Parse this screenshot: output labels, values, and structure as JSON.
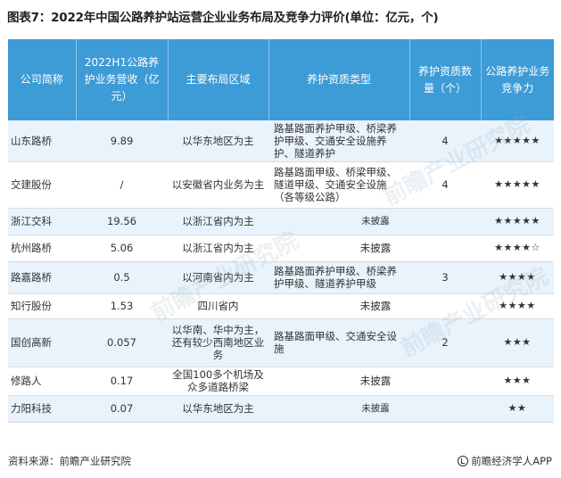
{
  "title": "图表7：2022年中国公路养护站运营企业业务布局及竞争力评价(单位：亿元，个)",
  "headers": [
    "公司简称",
    "2022H1公路养护业务营收（亿元）",
    "主要布局区域",
    "养护资质类型",
    "养护资质数量（个）",
    "公路养护业务竞争力"
  ],
  "rows": [
    {
      "name": "山东路桥",
      "revenue": "9.89",
      "region": "以华东地区为主",
      "qualification": "路基路面养护甲级、桥梁养护甲级、交通安全设施养护、隧道养护",
      "count": "4",
      "rating": "★★★★★"
    },
    {
      "name": "交建股份",
      "revenue": "/",
      "region": "以安徽省内业务为主",
      "qualification": "路基路面甲级、桥梁甲级、隧道甲级、交通安全设施（各等级公路）",
      "count": "4",
      "rating": "★★★★★"
    },
    {
      "name": "浙江交科",
      "revenue": "19.56",
      "region": "以浙江省内为主",
      "qualification": "未披露",
      "count": "",
      "rating": "★★★★★"
    },
    {
      "name": "杭州路桥",
      "revenue": "5.06",
      "region": "以浙江省内为主",
      "qualification": "未披露",
      "count": "",
      "rating": "★★★★☆"
    },
    {
      "name": "路嘉路桥",
      "revenue": "0.5",
      "region": "以河南省内为主",
      "qualification": "路基路面养护甲级、桥梁养护甲级、隧道养护甲级",
      "count": "3",
      "rating": "★★★★"
    },
    {
      "name": "知行股份",
      "revenue": "1.53",
      "region": "四川省内",
      "qualification": "未披露",
      "count": "",
      "rating": "★★★★"
    },
    {
      "name": "国创高新",
      "revenue": "0.057",
      "region": "以华南、华中为主，还有较少西南地区业务",
      "qualification": "路基路面甲级、交通安全设施",
      "count": "2",
      "rating": "★★★"
    },
    {
      "name": "修路人",
      "revenue": "0.17",
      "region": "全国100多个机场及众多道路桥梁",
      "qualification": "未披露",
      "count": "",
      "rating": "★★★"
    },
    {
      "name": "力阳科技",
      "revenue": "0.07",
      "region": "以华东地区为主",
      "qualification": "未披露",
      "count": "",
      "rating": "★★"
    }
  ],
  "footer": {
    "source": "资料来源：前瞻产业研究院",
    "brand": "前瞻经济学人APP",
    "brand_icon": "qianzhan-logo-icon"
  },
  "watermark": "前瞻产业研究院",
  "colors": {
    "header_bg": "#3d9bd6",
    "row_alt_bg": "#e9f3fb",
    "header_text": "#ffffff"
  }
}
